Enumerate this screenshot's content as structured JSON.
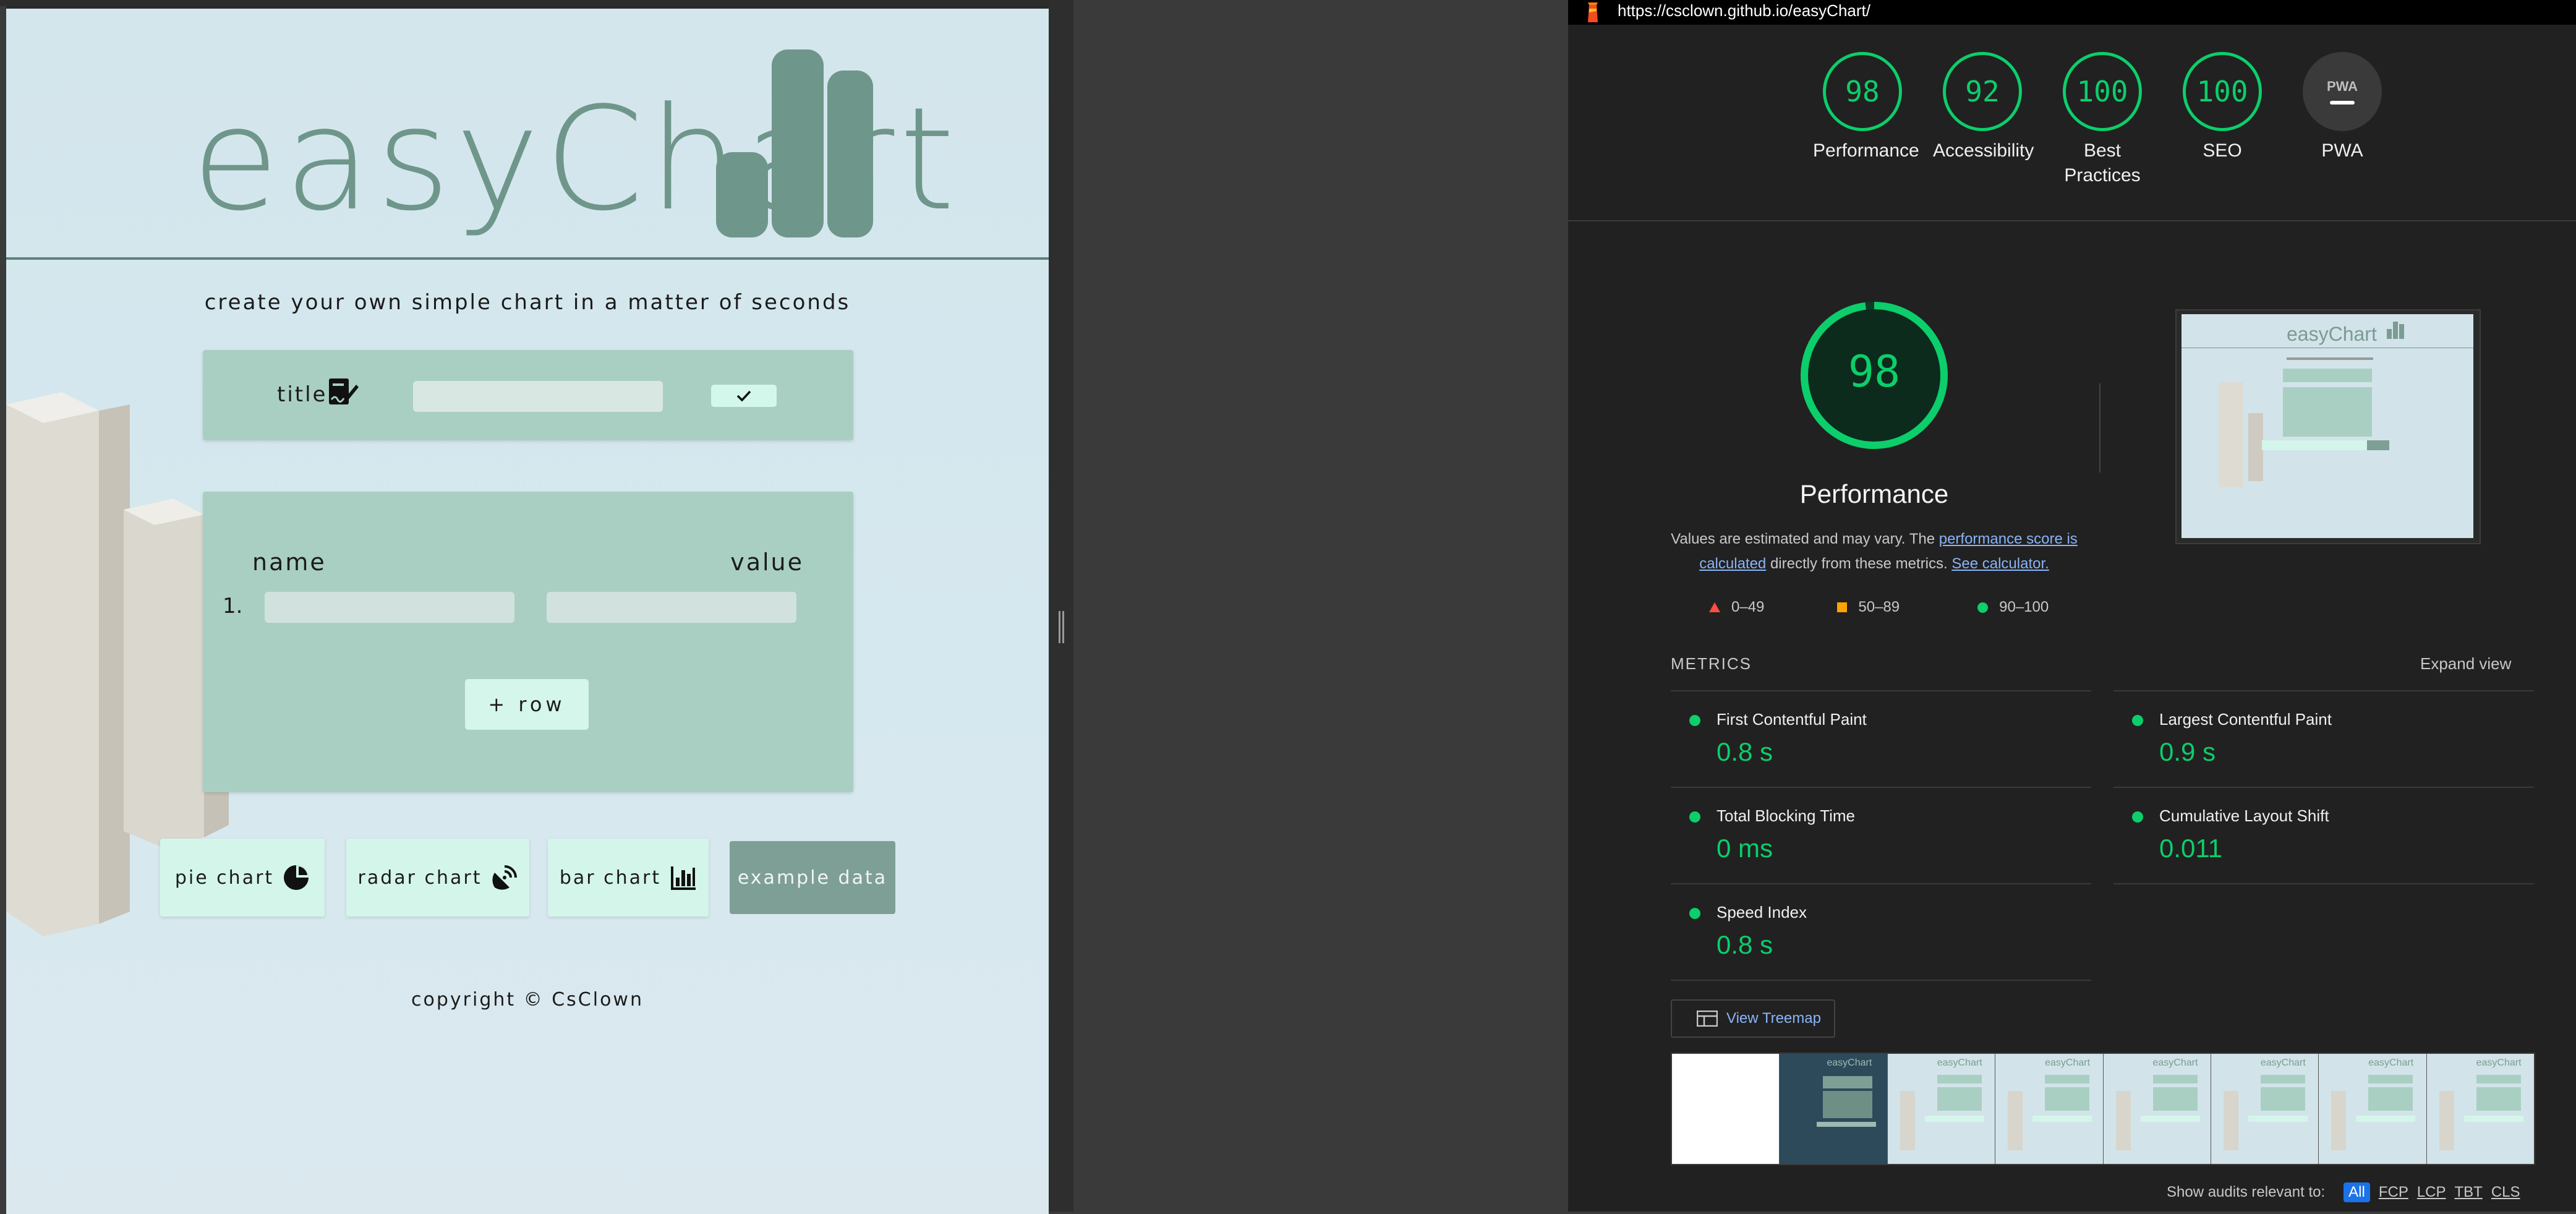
{
  "app": {
    "logo_text": "easyChart",
    "tagline": "create your own simple chart in a matter of seconds",
    "title_label": "title",
    "table": {
      "name_header": "name",
      "value_header": "value",
      "rows": [
        {
          "index": "1."
        }
      ]
    },
    "add_row_label": "+ row",
    "buttons": {
      "pie": "pie chart",
      "radar": "radar chart",
      "bar": "bar chart",
      "example": "example data"
    },
    "copyright": "copyright © CsClown"
  },
  "lighthouse": {
    "url": "https://csclown.github.io/easyChart/",
    "categories": [
      {
        "label": "Performance",
        "score": "98",
        "status": "pass"
      },
      {
        "label": "Accessibility",
        "score": "92",
        "status": "pass"
      },
      {
        "label": "Best Practices",
        "score": "100",
        "status": "pass"
      },
      {
        "label": "SEO",
        "score": "100",
        "status": "pass"
      },
      {
        "label": "PWA",
        "score": "PWA",
        "status": "na"
      }
    ],
    "main_score": "98",
    "main_title": "Performance",
    "desc_prefix": "Values are estimated and may vary. The ",
    "desc_link1": "performance score is calculated",
    "desc_middle": " directly from these metrics. ",
    "desc_link2": "See calculator.",
    "legend": [
      {
        "range": "0–49",
        "color": "#ff4e42"
      },
      {
        "range": "50–89",
        "color": "#ffa400"
      },
      {
        "range": "90–100",
        "color": "#0cce6b"
      }
    ],
    "metrics_title": "METRICS",
    "expand_view": "Expand view",
    "metrics": [
      {
        "name": "First Contentful Paint",
        "value": "0.8 s"
      },
      {
        "name": "Largest Contentful Paint",
        "value": "0.9 s"
      },
      {
        "name": "Total Blocking Time",
        "value": "0 ms"
      },
      {
        "name": "Cumulative Layout Shift",
        "value": "0.011"
      },
      {
        "name": "Speed Index",
        "value": "0.8 s"
      }
    ],
    "treemap_label": "View Treemap",
    "thumb_logo_text": "easyChart",
    "audits_label": "Show audits relevant to:",
    "audit_filters": [
      "All",
      "FCP",
      "LCP",
      "TBT",
      "CLS"
    ]
  },
  "colors": {
    "accent": "#6f968b",
    "card": "#a9cfc2",
    "button": "#d4f6ea",
    "lh_green": "#0cce6b",
    "link": "#8ab4f8"
  }
}
